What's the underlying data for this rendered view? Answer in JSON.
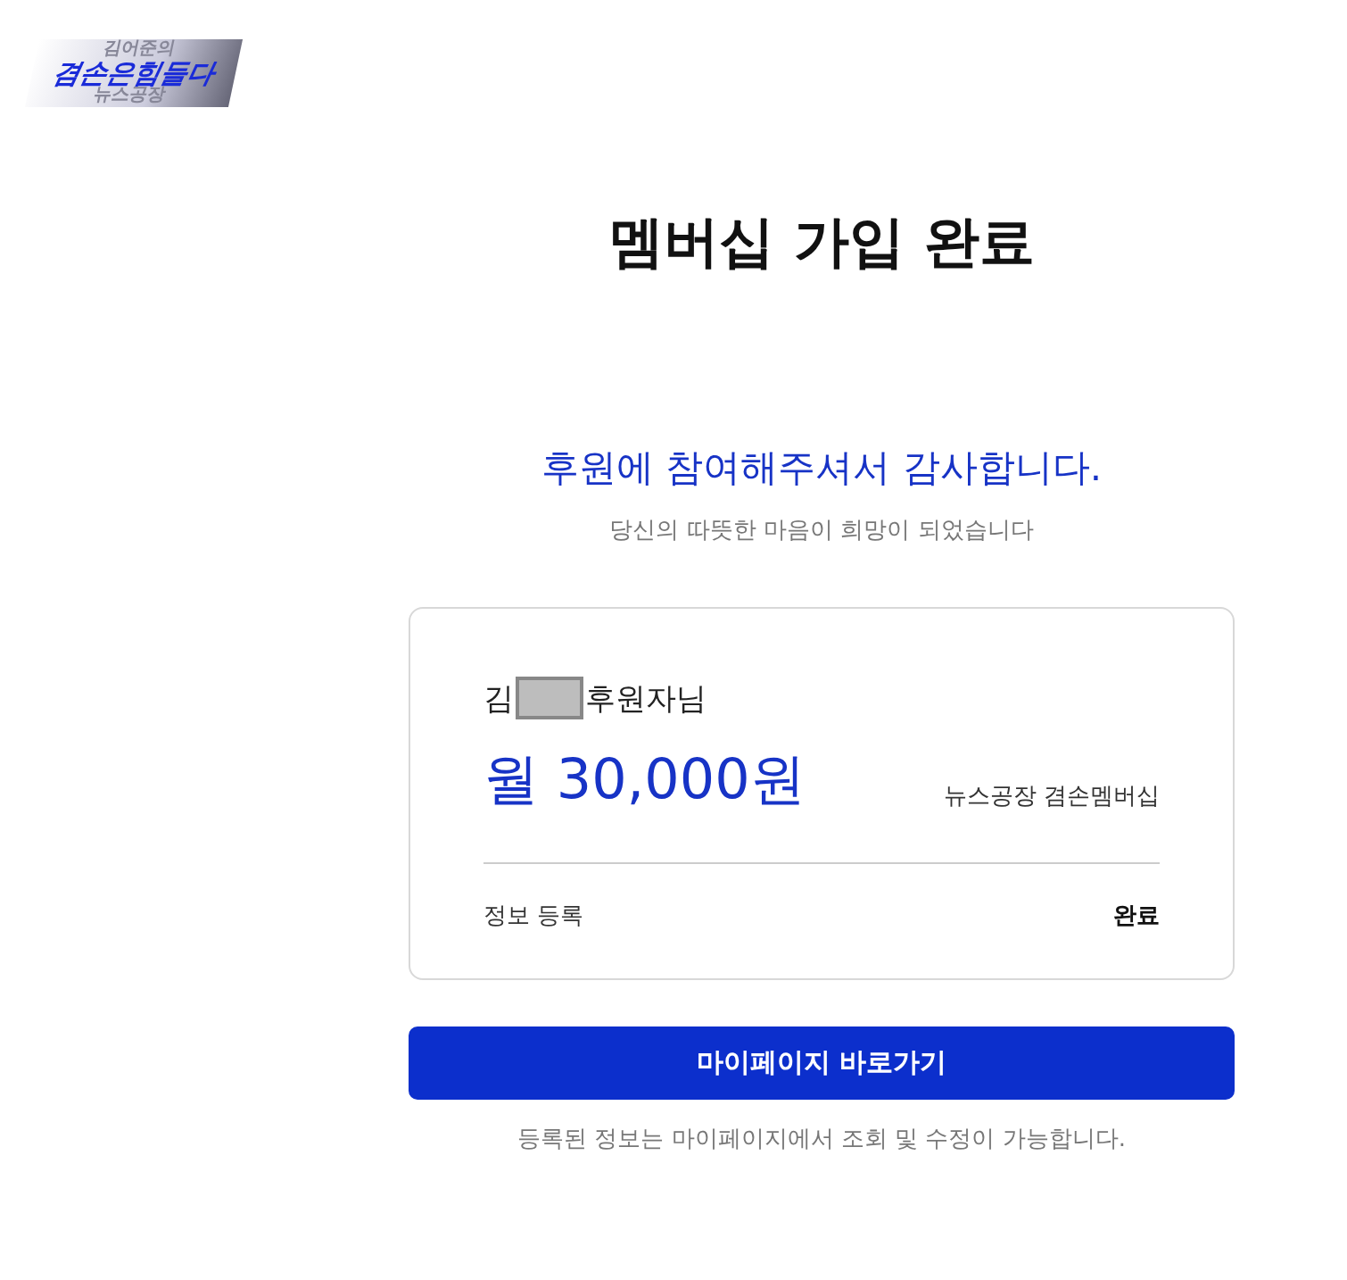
{
  "logo": {
    "top": "김어준의",
    "main": "겸손은힘들다",
    "bottom": "뉴스공장"
  },
  "title": "멤버십 가입 완료",
  "thanks": "후원에 참여해주셔서 감사합니다.",
  "subtitle": "당신의 따뜻한 마음이 희망이 되었습니다",
  "card": {
    "name_prefix": "김",
    "name_suffix": "후원자님",
    "amount": "월 30,000원",
    "plan": "뉴스공장 겸손멤버십",
    "info_label": "정보 등록",
    "info_status": "완료"
  },
  "button": "마이페이지 바로가기",
  "note": "등록된 정보는 마이페이지에서 조회 및 수정이 가능합니다."
}
